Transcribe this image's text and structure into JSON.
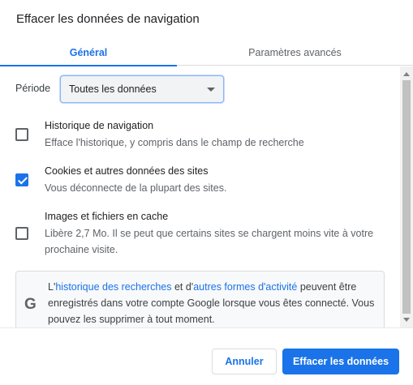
{
  "dialog": {
    "title": "Effacer les données de navigation"
  },
  "tabs": {
    "general": "Général",
    "advanced": "Paramètres avancés",
    "active": "general"
  },
  "period": {
    "label": "Période",
    "selected": "Toutes les données"
  },
  "options": {
    "history": {
      "title": "Historique de navigation",
      "description": "Efface l'historique, y compris dans le champ de recherche",
      "checked": false
    },
    "cookies": {
      "title": "Cookies et autres données des sites",
      "description": "Vous déconnecte de la plupart des sites.",
      "checked": true
    },
    "cache": {
      "title": "Images et fichiers en cache",
      "description": "Libère 2,7 Mo. Il se peut que certains sites se chargent moins vite à votre prochaine visite.",
      "checked": false
    }
  },
  "info": {
    "icon": "google-g-icon",
    "prefix": "L'",
    "link1": "historique des recherches",
    "middle": " et d'",
    "link2": "autres formes d'activité",
    "suffix": " peuvent être enregistrés dans votre compte Google lorsque vous êtes connecté. Vous pouvez les supprimer à tout moment."
  },
  "footer": {
    "cancel_label": "Annuler",
    "clear_label": "Effacer les données"
  },
  "colors": {
    "accent": "#1a73e8",
    "text": "#202124",
    "secondary_text": "#5f6368"
  }
}
